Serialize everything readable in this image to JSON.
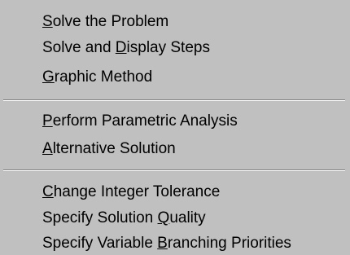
{
  "menu": {
    "groups": [
      {
        "items": [
          {
            "pre": "",
            "accel": "S",
            "post": "olve the Problem"
          },
          {
            "pre": "Solve and ",
            "accel": "D",
            "post": "isplay Steps"
          },
          {
            "pre": "",
            "accel": "G",
            "post": "raphic Method"
          }
        ]
      },
      {
        "items": [
          {
            "pre": "",
            "accel": "P",
            "post": "erform Parametric Analysis"
          },
          {
            "pre": "",
            "accel": "A",
            "post": "lternative Solution"
          }
        ]
      },
      {
        "items": [
          {
            "pre": "",
            "accel": "C",
            "post": "hange Integer Tolerance"
          },
          {
            "pre": "Specify Solution ",
            "accel": "Q",
            "post": "uality"
          },
          {
            "pre": "Specify Variable ",
            "accel": "B",
            "post": "ranching Priorities"
          }
        ]
      }
    ]
  }
}
